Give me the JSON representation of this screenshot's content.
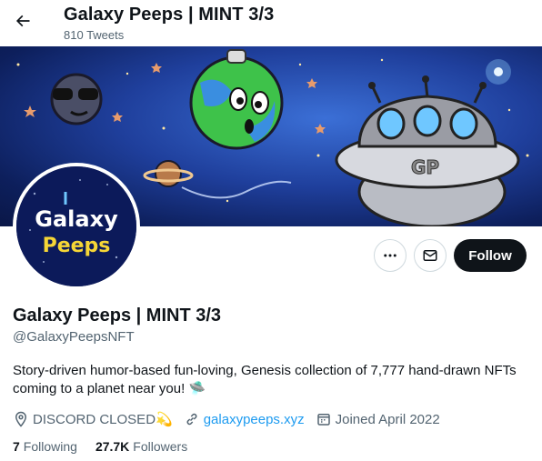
{
  "header": {
    "title": "Galaxy Peeps | MINT 3/3",
    "tweets_count": "810 Tweets"
  },
  "banner": {
    "ufo_plate_text": "GP"
  },
  "avatar": {
    "line1": "Galaxy",
    "line2": "Peeps"
  },
  "actions": {
    "follow_label": "Follow"
  },
  "profile": {
    "name": "Galaxy Peeps | MINT 3/3",
    "handle": "@GalaxyPeepsNFT",
    "bio": "Story-driven humor-based fun-loving, Genesis collection of 7,777 hand-drawn NFTs coming to a planet near you! 🛸",
    "location": "DISCORD CLOSED💫",
    "website": "galaxypeeps.xyz",
    "joined": "Joined April 2022"
  },
  "stats": {
    "following_count": "7",
    "following_label": "Following",
    "followers_count": "27.7K",
    "followers_label": "Followers"
  },
  "colors": {
    "accent": "#1d9bf0",
    "text": "#0f1419",
    "secondary": "#536471",
    "follow_bg": "#0f1419"
  }
}
